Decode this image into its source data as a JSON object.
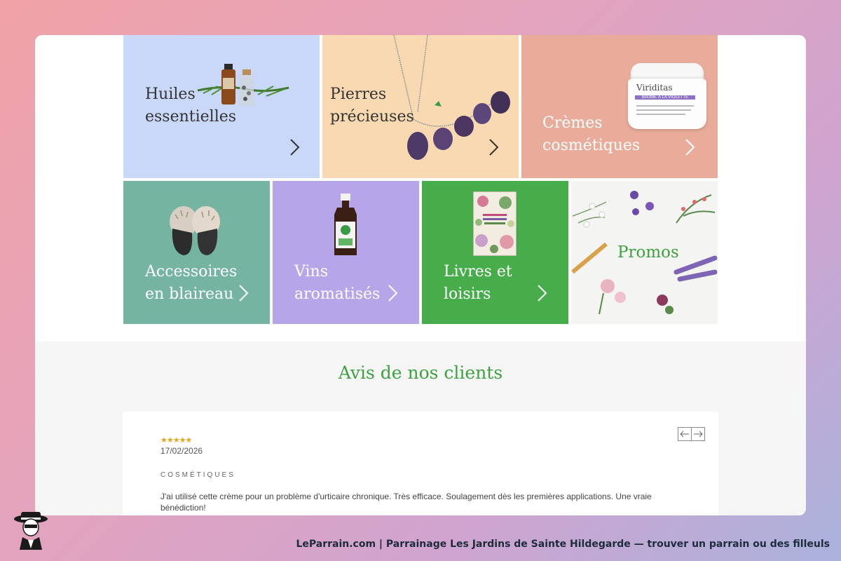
{
  "categories": {
    "huiles": {
      "label_line1": "Huiles",
      "label_line2": "essentielles",
      "bg": "#c9d8f8"
    },
    "pierres": {
      "label_line1": "Pierres",
      "label_line2": "précieuses",
      "bg": "#f8d9b1"
    },
    "cremes": {
      "label_line1": "Crèmes",
      "label_line2": "cosmétiques",
      "bg": "#e9ac9a",
      "jar_brand": "Viriditas",
      "jar_label": "BAUME À LA VIOLETTE"
    },
    "accessoires": {
      "label_line1": "Accessoires",
      "label_line2": "en blaireau",
      "bg": "#76b4a2"
    },
    "vins": {
      "label_line1": "Vins",
      "label_line2": "aromatisés",
      "bg": "#b6a6e9"
    },
    "livres": {
      "label_line1": "Livres et",
      "label_line2": "loisirs",
      "bg": "#46ad4a"
    },
    "promos": {
      "label": "Promos",
      "bg": "#f4f4f2",
      "label_color": "#3ba23f"
    }
  },
  "reviews": {
    "title": "Avis de nos clients",
    "stars": "★★★★★",
    "rating": 5,
    "date": "17/02/2026",
    "category": "COSMÉTIQUES",
    "text": "J'ai utilisé cette crème pour un problème d'urticaire chronique. Très efficace. Soulagement dès les premières applications. Une vraie bénédiction!",
    "accent": "#3ba23f"
  },
  "footer": {
    "text": "LeParrain.com | Parrainage Les Jardins de Sainte Hildegarde — trouver un parrain ou des filleuls"
  }
}
